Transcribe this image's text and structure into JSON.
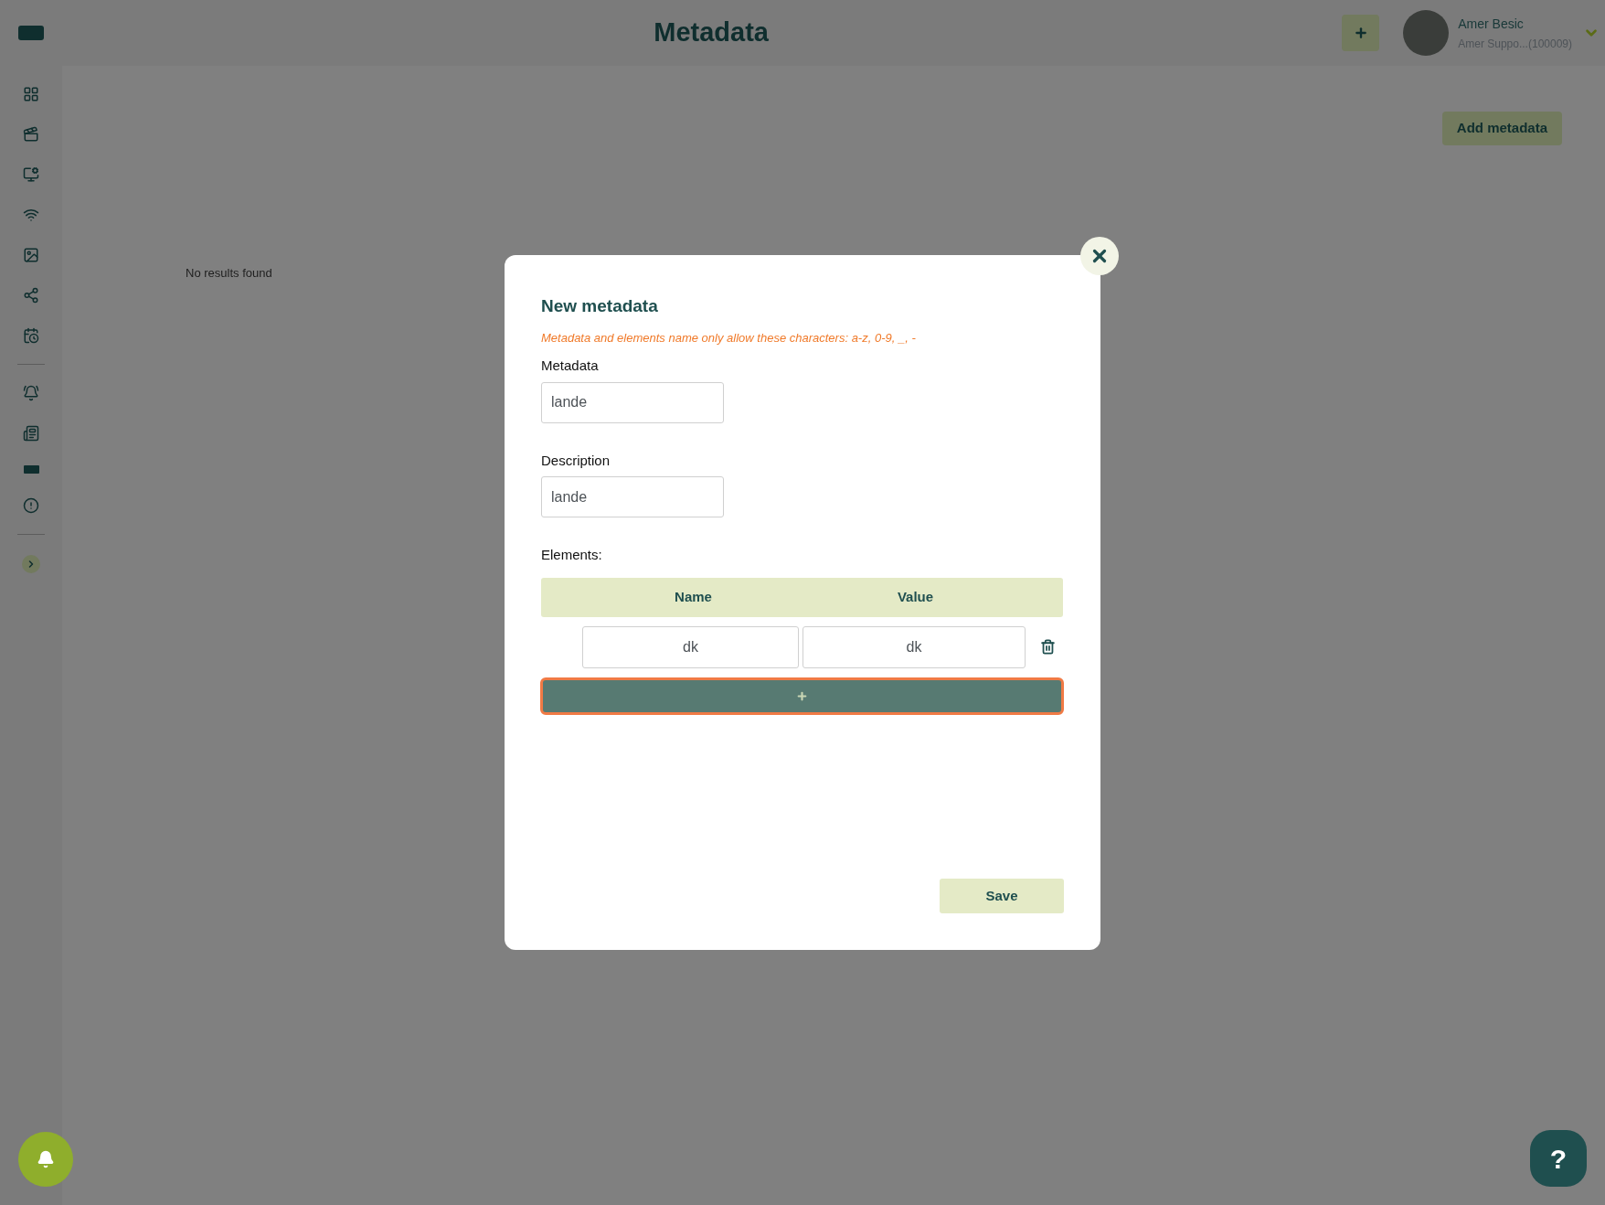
{
  "header": {
    "title": "Metadata",
    "user": {
      "name": "Amer Besic",
      "subtitle": "Amer Suppo...(100009)"
    }
  },
  "main": {
    "empty_message": "No results found",
    "add_button": "Add metadata"
  },
  "dialog": {
    "title": "New metadata",
    "hint": "Metadata and elements name only allow these characters: a-z, 0-9, _, -",
    "fields": [
      {
        "label": "Metadata",
        "value": "lande"
      },
      {
        "label": "Description",
        "value": "lande"
      }
    ],
    "elements_label": "Elements:",
    "columns": [
      "Name",
      "Value"
    ],
    "rows": [
      {
        "name": "dk",
        "value": "dk"
      }
    ],
    "add_row_button": {
      "focused": true
    },
    "save_button": "Save"
  },
  "help_button": "?"
}
